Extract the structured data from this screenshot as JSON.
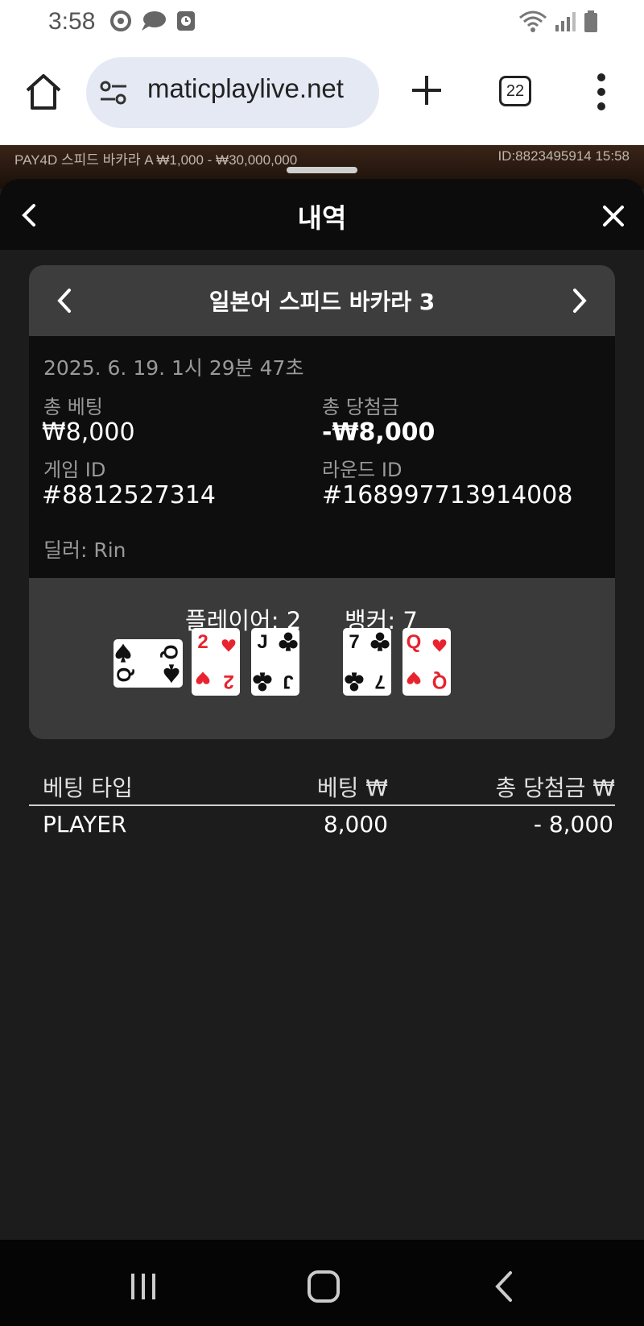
{
  "status_bar": {
    "time": "3:58"
  },
  "browser": {
    "url": "maticplaylive.net",
    "tab_count": "22"
  },
  "game_strip": {
    "left_text": "PAY4D 스피드 바카라 A   ₩1,000 - ₩30,000,000",
    "right_text": "ID:8823495914   15:58"
  },
  "sheet": {
    "title": "내역"
  },
  "round": {
    "game_name": "일본어 스피드 바카라 3",
    "datetime": "2025. 6. 19. 1시 29분 47초",
    "total_bet_label": "총 베팅",
    "total_bet_value": "₩8,000",
    "total_win_label": "총 당첨금",
    "total_win_value": "-₩8,000",
    "game_id_label": "게임 ID",
    "game_id_value": "#8812527314",
    "round_id_label": "라운드 ID",
    "round_id_value": "#168997713914008",
    "dealer": "딜러: Rin",
    "player_score": "플레이어: 2",
    "banker_score": "뱅커: 7",
    "player_cards": [
      {
        "rank": "Q",
        "suit": "spades",
        "color": "#111111"
      },
      {
        "rank": "2",
        "suit": "hearts",
        "color": "#e8232f"
      },
      {
        "rank": "J",
        "suit": "clubs",
        "color": "#111111"
      }
    ],
    "banker_cards": [
      {
        "rank": "7",
        "suit": "clubs",
        "color": "#111111"
      },
      {
        "rank": "Q",
        "suit": "hearts",
        "color": "#e8232f"
      }
    ]
  },
  "bet_table": {
    "headers": [
      "베팅 타입",
      "베팅 ₩",
      "총 당첨금 ₩"
    ],
    "rows": [
      {
        "type": "PLAYER",
        "bet": "8,000",
        "win": "- 8,000"
      }
    ]
  },
  "colors": {
    "sheet_bg": "#1c1c1c",
    "panel_bg": "#3a3a3a",
    "info_bg": "#0e0e0e",
    "red_suit": "#e8232f"
  },
  "icons": [
    "home-icon",
    "tune-icon",
    "plus-icon",
    "tabs-icon",
    "more-vert-icon",
    "chevron-left-icon",
    "close-icon",
    "chevron-right-icon"
  ]
}
